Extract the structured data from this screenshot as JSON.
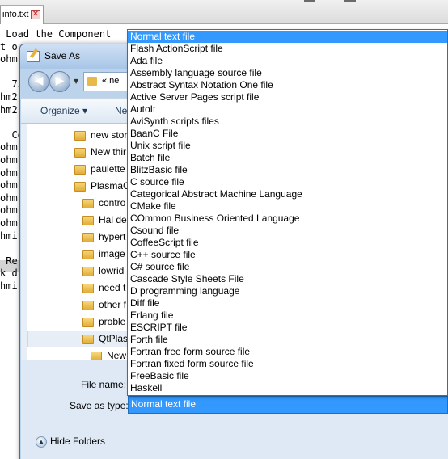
{
  "editor": {
    "tab_label": "info.txt",
    "tab_close": "✕",
    "lines": [
      " Load the Component",
      "t o",
      "ohm",
      "",
      "  7i",
      "hm2",
      "hm2",
      "",
      "  Co",
      "ohm",
      "ohm",
      "ohm",
      "ohm",
      "ohm",
      "ohm",
      "ohm",
      "hmi",
      "",
      " Re",
      "k d",
      "hmi"
    ]
  },
  "dialog": {
    "title": "Save As",
    "address": "« ne",
    "toolbar": {
      "organize": "Organize ▾",
      "new_folder": "Ne"
    },
    "tree_items": [
      {
        "label": "new stor",
        "indent": 0
      },
      {
        "label": "New thir",
        "indent": 0
      },
      {
        "label": "paulette",
        "indent": 0
      },
      {
        "label": "PlasmaC",
        "indent": 0
      },
      {
        "label": "contro",
        "indent": 1
      },
      {
        "label": "Hal de",
        "indent": 1
      },
      {
        "label": "hypert",
        "indent": 1
      },
      {
        "label": "image",
        "indent": 1
      },
      {
        "label": "lowrid",
        "indent": 1
      },
      {
        "label": "need t",
        "indent": 1
      },
      {
        "label": "other f",
        "indent": 1
      },
      {
        "label": "proble",
        "indent": 1
      },
      {
        "label": "QtPlas",
        "indent": 1
      },
      {
        "label": "New",
        "indent": 2
      },
      {
        "label": "",
        "indent": 2
      }
    ],
    "file_name_label": "File name:",
    "save_as_type_label": "Save as type:",
    "save_as_type_value": "Normal text file",
    "hide_folders": "Hide Folders"
  },
  "dropdown": {
    "selected_index": 0,
    "items": [
      "Normal text file",
      "Flash ActionScript file",
      "Ada file",
      "Assembly language source file",
      "Abstract Syntax Notation One file",
      "Active Server Pages script file",
      "AutoIt",
      "AviSynth scripts files",
      "BaanC File",
      "Unix script file",
      "Batch file",
      "BlitzBasic file",
      "C source file",
      "Categorical Abstract Machine Language",
      "CMake file",
      "COmmon Business Oriented Language",
      "Csound file",
      "CoffeeScript file",
      "C++ source file",
      "C# source file",
      "Cascade Style Sheets File",
      "D programming language",
      "Diff file",
      "Erlang file",
      "ESCRIPT file",
      "Forth file",
      "Fortran free form source file",
      "Fortran fixed form source file",
      "FreeBasic file",
      "Haskell"
    ]
  },
  "colors": {
    "selection": "#3399ff",
    "dialog_frame": "#bcd3ec"
  }
}
